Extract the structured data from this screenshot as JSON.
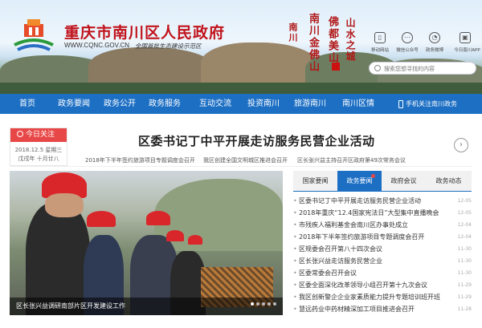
{
  "header": {
    "title": "重庆市南川区人民政府",
    "domain": "WWW.CQNC.GOV.CN",
    "slogan": "全国首批生态建设示范区",
    "calligraphy": [
      "南川金佛山",
      "佛都美山",
      "山水之城",
      "南川"
    ],
    "quick_links": [
      {
        "label": "移动网站",
        "icon": "mobile-icon"
      },
      {
        "label": "微信公众号",
        "icon": "wechat-icon"
      },
      {
        "label": "政务微博",
        "icon": "weibo-icon"
      },
      {
        "label": "今日南川APP",
        "icon": "app-icon"
      }
    ],
    "search": {
      "placeholder": "搜索您想寻找的内容"
    }
  },
  "nav": {
    "items": [
      "首页",
      "政务要闻",
      "政务公开",
      "政务服务",
      "互动交流",
      "投资南川",
      "旅游南川",
      "南川区情"
    ],
    "mobile": "手机关注南川政务"
  },
  "today": {
    "title": "今日关注",
    "date_line1": "2018.12.5 星期三",
    "date_line2": "戊戌年 十月廿八"
  },
  "headline": "区委书记丁中平开展走访服务民营企业活动",
  "sub_links": [
    "2018年下半年签约旅游项目专题调度会召开",
    "我区创建全国文明城区推进会召开",
    "区长张兴益主持召开区政府第49次常务会议"
  ],
  "photo": {
    "caption": "区长张兴益调研南部片区开发建设工作"
  },
  "tabs": [
    {
      "label": "国家要闻",
      "active": false
    },
    {
      "label": "政务要闻",
      "active": true
    },
    {
      "label": "政府会议",
      "active": false
    },
    {
      "label": "政务动态",
      "active": false
    }
  ],
  "news": [
    {
      "text": "区委书记丁中平开展走访服务民营企业活动",
      "date": "12-05"
    },
    {
      "text": "2018年重庆“12.4国家宪法日”大型集中直播晚会",
      "date": "12-05"
    },
    {
      "text": "市残疾人福利基金会南川区办事处成立",
      "date": "12-04"
    },
    {
      "text": "2018年下半年签约旅游项目专题调度会召开",
      "date": "12-04"
    },
    {
      "text": "区规委会召开第八十四次会议",
      "date": "11-30"
    },
    {
      "text": "区长张兴益走访服务民营企业",
      "date": "11-30"
    },
    {
      "text": "区委常委会召开会议",
      "date": "11-30"
    },
    {
      "text": "区委全面深化改革领导小组召开第十九次会议",
      "date": "11-29"
    },
    {
      "text": "我区创新警企企业家素质能力提升专题培训班开班",
      "date": "11-29"
    },
    {
      "text": "慧远药业中药材精深加工项目推进会召开",
      "date": "11-28"
    }
  ],
  "colors": {
    "brand_red": "#c1121b",
    "nav_blue": "#1d6fc4",
    "accent_red": "#e84747"
  }
}
